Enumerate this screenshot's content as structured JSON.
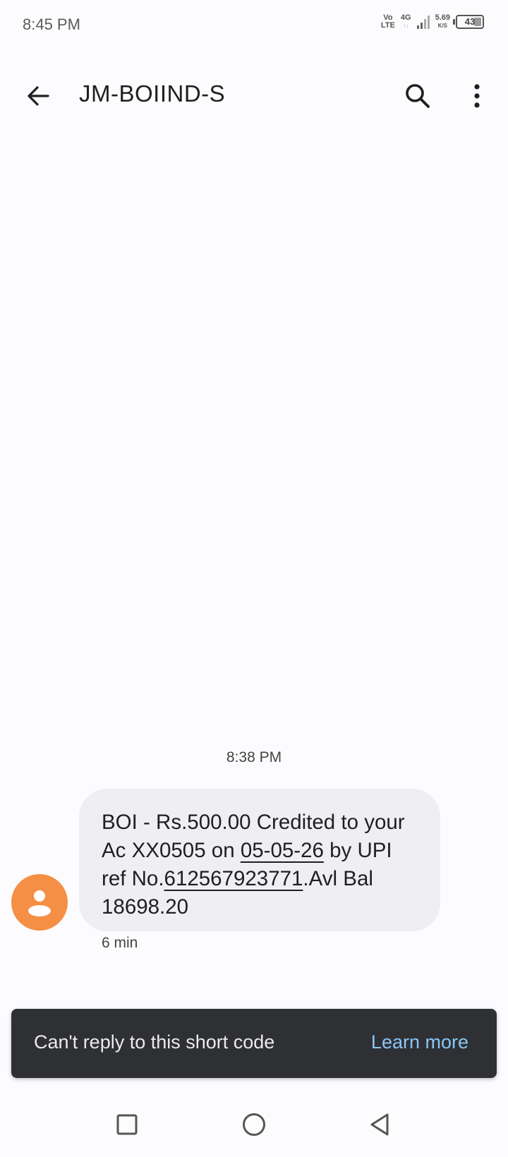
{
  "status_bar": {
    "time": "8:45 PM",
    "volte_top": "Vo",
    "volte_bottom": "LTE",
    "network_type": "4G",
    "speed_value": "5.69",
    "speed_unit": "K/S",
    "battery_level": "43"
  },
  "app_bar": {
    "title": "JM-BOIIND-S",
    "icons": {
      "back": "arrow-back-icon",
      "search": "search-icon",
      "more": "more-vert-icon"
    }
  },
  "conversation": {
    "timestamp": "8:38 PM",
    "message": {
      "part1": "BOI -  Rs.500.00 Credited to your Ac XX0505 on ",
      "date_link": "05-05-26",
      "part2": " by UPI ref No.",
      "ref_link": "612567923771",
      "part3": ".Avl Bal 18698.20",
      "age": "6 min"
    },
    "avatar_color": "#f58f45"
  },
  "snackbar": {
    "text": "Can't reply to this short code",
    "action": "Learn more",
    "action_color": "#8ac6f5"
  },
  "nav_bar": {
    "icons": [
      "recents-square-icon",
      "home-circle-icon",
      "back-triangle-icon"
    ]
  }
}
